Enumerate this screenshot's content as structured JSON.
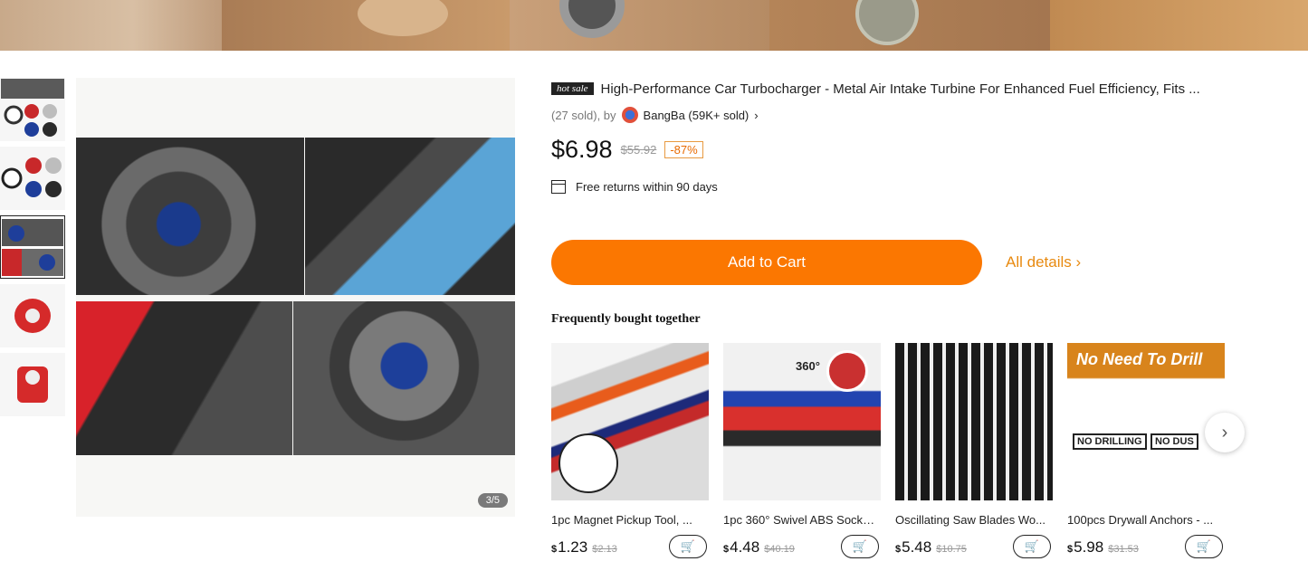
{
  "product": {
    "hot_badge": "hot sale",
    "title": "High-Performance Car Turbocharger - Metal Air Intake Turbine For Enhanced Fuel Efficiency, Fits ...",
    "sold": "(27 sold), by",
    "seller": "BangBa (59K+ sold)",
    "price": "$6.98",
    "old_price": "$55.92",
    "discount": "-87%",
    "returns": "Free returns within 90 days",
    "add_to_cart": "Add to Cart",
    "all_details": "All details",
    "image_counter": "3/5"
  },
  "fbt": {
    "title": "Frequently bought together",
    "items": [
      {
        "name": "1pc Magnet Pickup Tool, ...",
        "currency": "$",
        "price": "1.23",
        "old_price": "$2.13"
      },
      {
        "name": "1pc 360° Swivel ABS Socke...",
        "currency": "$",
        "price": "4.48",
        "old_price": "$40.19"
      },
      {
        "name": "Oscillating Saw Blades Wo...",
        "currency": "$",
        "price": "5.48",
        "old_price": "$10.75"
      },
      {
        "name": "100pcs Drywall Anchors - ...",
        "currency": "$",
        "price": "5.98",
        "old_price": "$31.53"
      }
    ],
    "img_text": {
      "rotation": "360°",
      "no_need": "No Need To Drill",
      "no_drilling": "NO DRILLING",
      "no_dust": "NO DUS"
    }
  },
  "icons": {
    "cart": "cart-plus-icon",
    "chevron": "chevron-right-icon"
  },
  "colors": {
    "accent": "#fb7701",
    "link": "#e88a10",
    "discount": "#e86a00"
  }
}
